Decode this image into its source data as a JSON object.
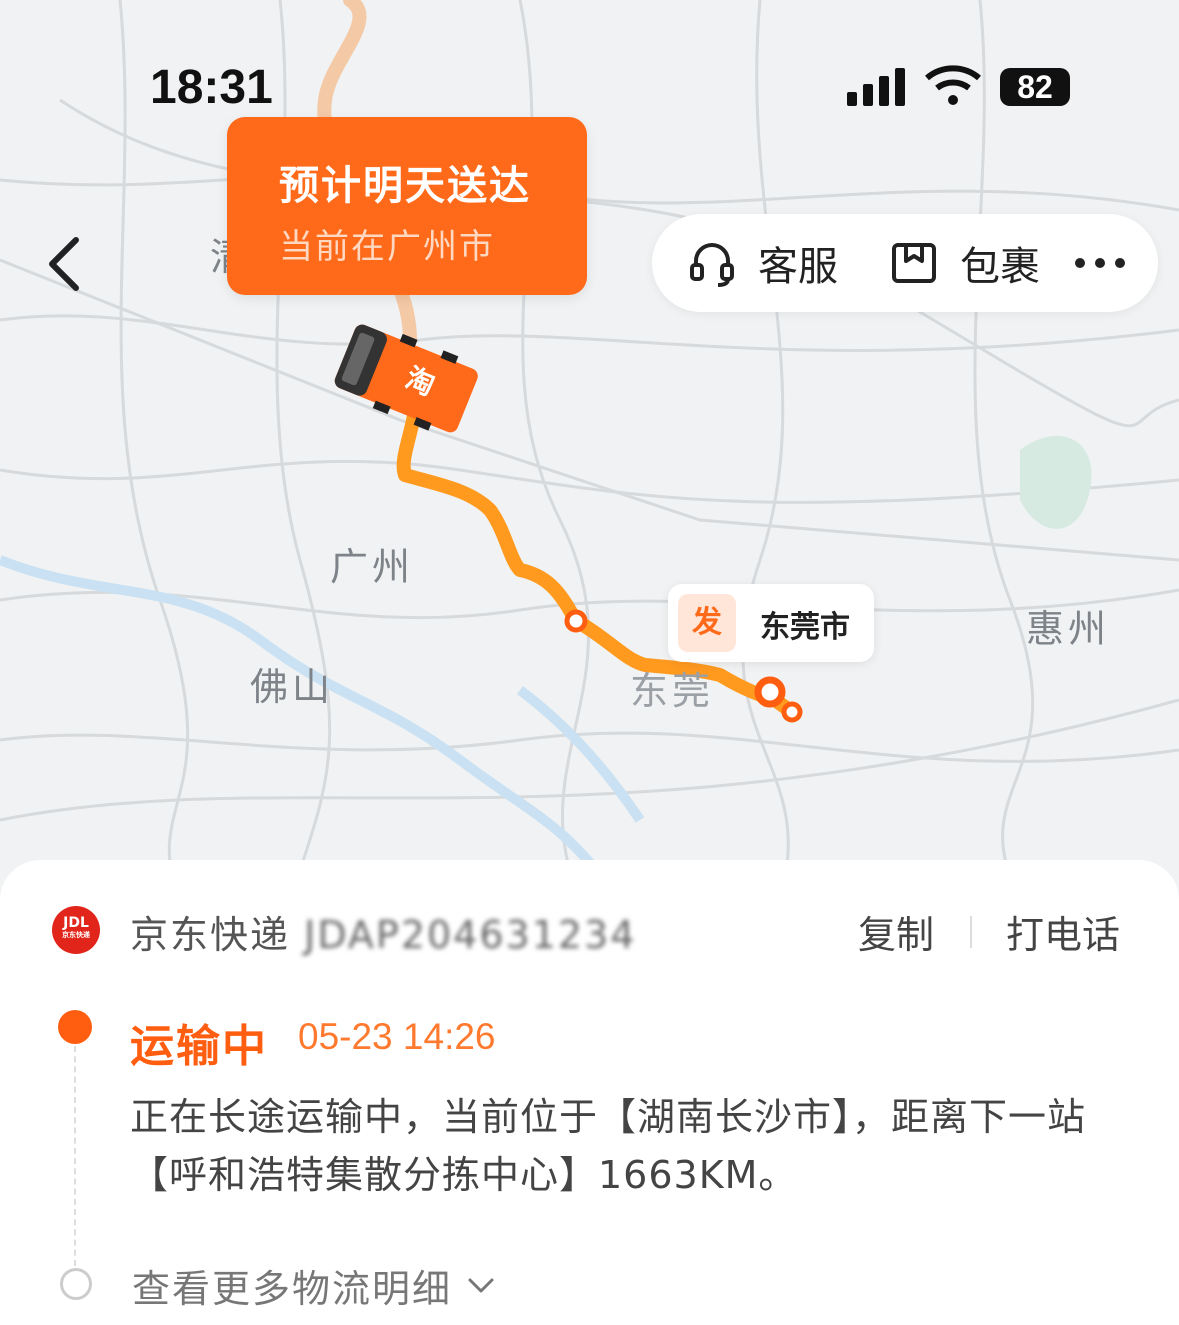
{
  "status_bar": {
    "time": "18:31",
    "battery": "82"
  },
  "eta_card": {
    "title": "预计明天送达",
    "subtitle": "当前在广州市"
  },
  "toolbar": {
    "service_label": "客服",
    "package_label": "包裹"
  },
  "map": {
    "cities": {
      "guangzhou": "广州",
      "foshan": "佛山",
      "dongguan": "东莞",
      "huizhou": "惠州",
      "partial": "清"
    },
    "origin_tag": {
      "badge": "发",
      "label": "东莞市"
    },
    "truck_badge": "淘"
  },
  "shipment": {
    "carrier_logo": "JDL",
    "carrier_logo_sub": "京东快递",
    "carrier_name": "京东快递",
    "waybill_number": "JDAP204631234",
    "copy_label": "复制",
    "call_label": "打电话"
  },
  "tracking": {
    "status": "运输中",
    "time": "05-23 14:26",
    "description": "正在长途运输中，当前位于【湖南长沙市】，距离下一站【呼和浩特集散分拣中心】1663KM。",
    "more_label": "查看更多物流明细"
  },
  "colors": {
    "accent": "#ff6a1a",
    "route": "#ff9a1f",
    "panel": "#ffffff",
    "logo": "#e1251b"
  }
}
